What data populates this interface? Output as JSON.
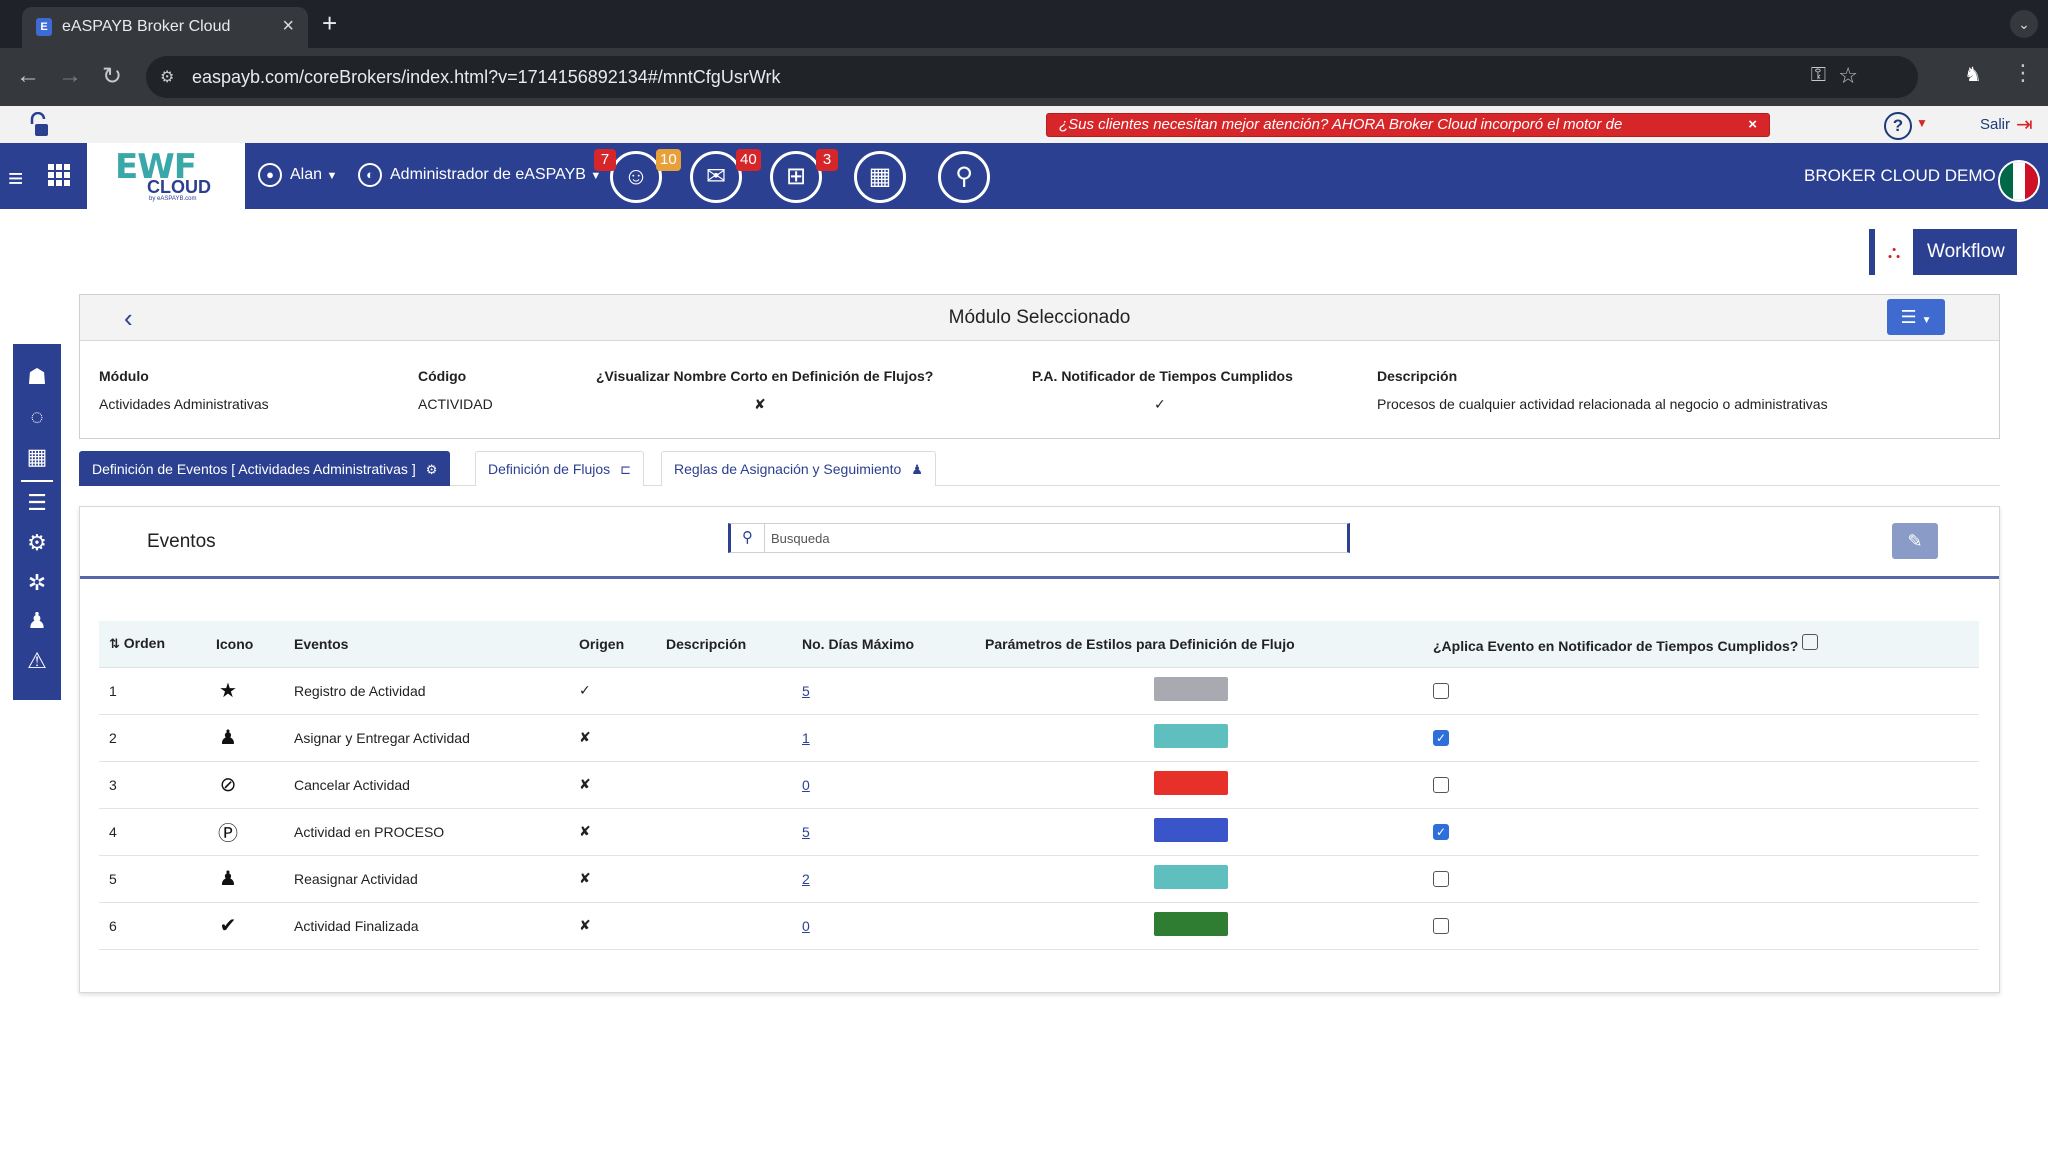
{
  "browser": {
    "tab_title": "eASPAYB Broker Cloud",
    "favicon_letter": "E",
    "url": "easpayb.com/coreBrokers/index.html?v=1714156892134#/mntCfgUsrWrk"
  },
  "strip": {
    "promo_text": "¿Sus clientes necesitan mejor atención? AHORA Broker Cloud incorporó el motor de",
    "promo_close": "×",
    "help": "?",
    "logout_label": "Salir"
  },
  "header": {
    "logo_main": "EWF",
    "logo_cloud": "CLOUD",
    "logo_by": "by eASPAYB.com",
    "user_name": "Alan",
    "role": "Administrador de eASPAYB",
    "badges": {
      "contacts": "7",
      "contacts2": "10",
      "mail": "40",
      "gifts": "3"
    },
    "brand": "BROKER CLOUD DEMO",
    "flag_colors": [
      "#006847",
      "#ffffff",
      "#ce1126"
    ]
  },
  "workflow_button": "Workflow",
  "module": {
    "title": "Módulo Seleccionado",
    "fields": {
      "modulo_label": "Módulo",
      "modulo_value": "Actividades Administrativas",
      "codigo_label": "Código",
      "codigo_value": "ACTIVIDAD",
      "nombre_corto_label": "¿Visualizar Nombre Corto en Definición de Flujos?",
      "nombre_corto_value": "✘",
      "notificador_label": "P.A. Notificador de Tiempos Cumplidos",
      "notificador_value": "✓",
      "descripcion_label": "Descripción",
      "descripcion_value": "Procesos de cualquier actividad relacionada al negocio o administrativas"
    }
  },
  "tabs": [
    {
      "label": "Definición de Eventos [ Actividades Administrativas ]",
      "icon": "gears-icon",
      "active": true
    },
    {
      "label": "Definición de Flujos",
      "icon": "flow-icon",
      "active": false
    },
    {
      "label": "Reglas de Asignación y Seguimiento",
      "icon": "person-icon",
      "active": false
    }
  ],
  "events": {
    "title": "Eventos",
    "search_placeholder": "Busqueda",
    "columns": {
      "orden": "Orden",
      "icono": "Icono",
      "eventos": "Eventos",
      "origen": "Origen",
      "descripcion": "Descripción",
      "dias": "No. Días Máximo",
      "estilos": "Parámetros de Estilos para Definición de Flujo",
      "aplica": "¿Aplica Evento en Notificador de Tiempos Cumplidos?"
    },
    "rows": [
      {
        "orden": "1",
        "icon": "star-icon",
        "glyph": "★",
        "evento": "Registro de Actividad",
        "origen": "✓",
        "descripcion": "",
        "dias": "5",
        "color": "#a9a9b1",
        "aplica": false
      },
      {
        "orden": "2",
        "icon": "person-icon",
        "glyph": "♟",
        "evento": "Asignar y Entregar Actividad",
        "origen": "✘",
        "descripcion": "",
        "dias": "1",
        "color": "#5fbfbf",
        "aplica": true
      },
      {
        "orden": "3",
        "icon": "ban-icon",
        "glyph": "⊘",
        "evento": "Cancelar Actividad",
        "origen": "✘",
        "descripcion": "",
        "dias": "0",
        "color": "#e8302a",
        "aplica": false
      },
      {
        "orden": "4",
        "icon": "parking-icon",
        "glyph": "Ⓟ",
        "evento": "Actividad en PROCESO",
        "origen": "✘",
        "descripcion": "",
        "dias": "5",
        "color": "#3a55c9",
        "aplica": true
      },
      {
        "orden": "5",
        "icon": "person-icon",
        "glyph": "♟",
        "evento": "Reasignar Actividad",
        "origen": "✘",
        "descripcion": "",
        "dias": "2",
        "color": "#5fbfbf",
        "aplica": false
      },
      {
        "orden": "6",
        "icon": "check-icon",
        "glyph": "✔",
        "evento": "Actividad Finalizada",
        "origen": "✘",
        "descripcion": "",
        "dias": "0",
        "color": "#2e7d32",
        "aplica": false
      }
    ]
  },
  "colors": {
    "primary": "#2c4092",
    "accent": "#3f6ad0",
    "alert": "#d7262a"
  }
}
